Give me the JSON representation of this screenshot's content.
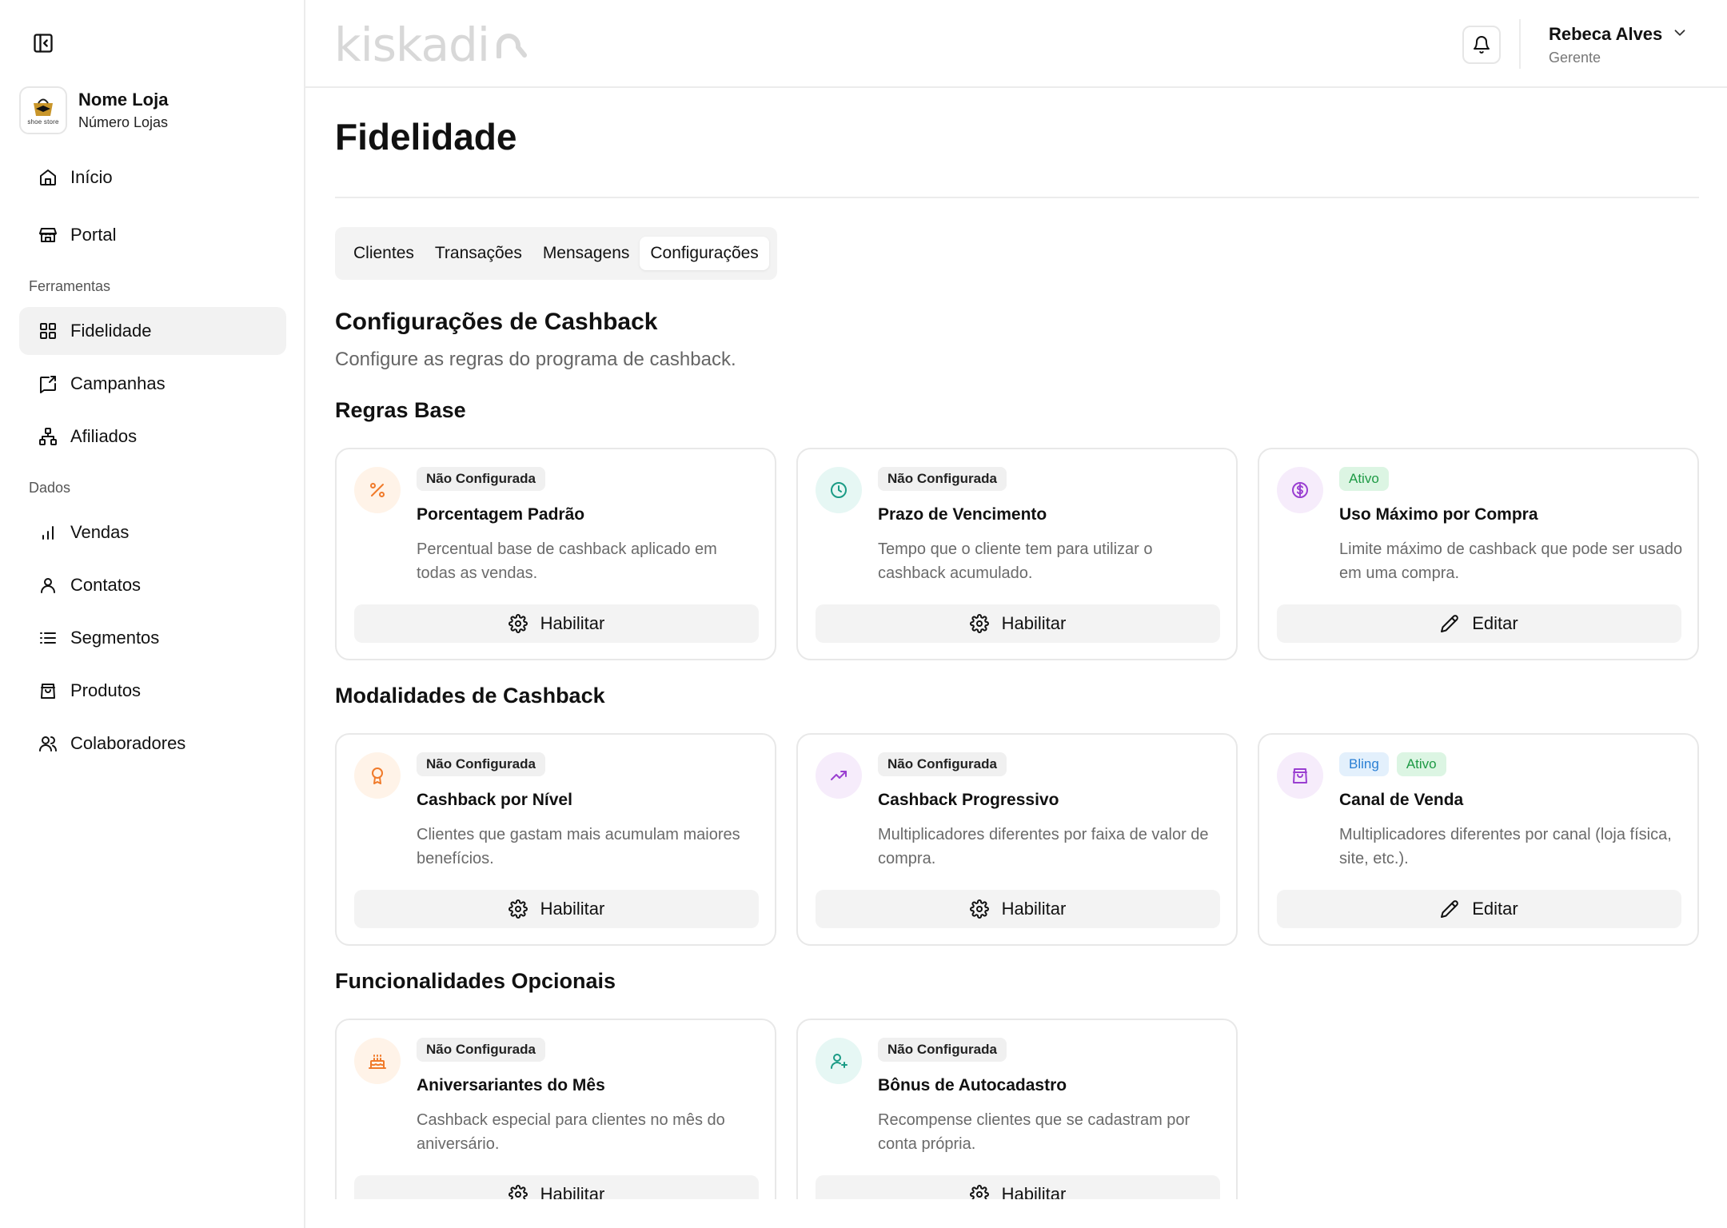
{
  "sidebar": {
    "store": {
      "name": "Nome Loja",
      "subtitle": "Número Lojas",
      "logo_text": "shoe store"
    },
    "items_top": [
      {
        "label": "Início",
        "icon": "home-icon"
      },
      {
        "label": "Portal",
        "icon": "store-icon"
      }
    ],
    "section_tools": "Ferramentas",
    "items_tools": [
      {
        "label": "Fidelidade",
        "icon": "grid-icon",
        "active": true
      },
      {
        "label": "Campanhas",
        "icon": "message-share-icon"
      },
      {
        "label": "Afiliados",
        "icon": "network-icon"
      }
    ],
    "section_data": "Dados",
    "items_data": [
      {
        "label": "Vendas",
        "icon": "bar-chart-icon"
      },
      {
        "label": "Contatos",
        "icon": "user-icon"
      },
      {
        "label": "Segmentos",
        "icon": "list-icon"
      },
      {
        "label": "Produtos",
        "icon": "shopping-bag-icon"
      },
      {
        "label": "Colaboradores",
        "icon": "users-icon"
      }
    ]
  },
  "header": {
    "brand": "kiskadi",
    "user": {
      "name": "Rebeca Alves",
      "role": "Gerente"
    }
  },
  "main": {
    "title": "Fidelidade",
    "tabs": [
      {
        "label": "Clientes",
        "active": false
      },
      {
        "label": "Transações",
        "active": false
      },
      {
        "label": "Mensagens",
        "active": false
      },
      {
        "label": "Configurações",
        "active": true
      }
    ],
    "section_title": "Configurações de Cashback",
    "section_subtitle": "Configure as regras do programa de cashback.",
    "groups": [
      {
        "title": "Regras Base",
        "cards": [
          {
            "icon": "percent-icon",
            "badges": [
              "Não Configurada"
            ],
            "title": "Porcentagem Padrão",
            "description": "Percentual base de cashback aplicado em todas as vendas.",
            "button": "Habilitar"
          },
          {
            "icon": "clock-icon",
            "badges": [
              "Não Configurada"
            ],
            "title": "Prazo de Vencimento",
            "description": "Tempo que o cliente tem para utilizar o cashback acumulado.",
            "button": "Habilitar"
          },
          {
            "icon": "dollar-circle-icon",
            "badges": [
              "Ativo"
            ],
            "title": "Uso Máximo por Compra",
            "description": "Limite máximo de cashback que pode ser usado em uma compra.",
            "button": "Editar"
          }
        ]
      },
      {
        "title": "Modalidades de Cashback",
        "cards": [
          {
            "icon": "award-icon",
            "badges": [
              "Não Configurada"
            ],
            "title": "Cashback por Nível",
            "description": "Clientes que gastam mais acumulam maiores benefícios.",
            "button": "Habilitar"
          },
          {
            "icon": "trending-up-icon",
            "badges": [
              "Não Configurada"
            ],
            "title": "Cashback Progressivo",
            "description": "Multiplicadores diferentes por faixa de valor de compra.",
            "button": "Habilitar"
          },
          {
            "icon": "shopping-bag-icon",
            "badges": [
              "Bling",
              "Ativo"
            ],
            "title": "Canal de Venda",
            "description": "Multiplicadores diferentes por canal (loja física, site, etc.).",
            "button": "Editar"
          }
        ]
      },
      {
        "title": "Funcionalidades Opcionais",
        "cards": [
          {
            "icon": "cake-icon",
            "badges": [
              "Não Configurada"
            ],
            "title": "Aniversariantes do Mês",
            "description": "Cashback especial para clientes no mês do aniversário.",
            "button": "Habilitar"
          },
          {
            "icon": "user-plus-icon",
            "badges": [
              "Não Configurada"
            ],
            "title": "Bônus de Autocadastro",
            "description": "Recompense clientes que se cadastram por conta própria.",
            "button": "Habilitar"
          }
        ]
      }
    ]
  },
  "colors": {
    "orange_icon": "#f07a2a",
    "teal_icon": "#1a9b85",
    "purple_icon": "#9a3fd1",
    "badge_green": "#1e9a45",
    "badge_blue": "#2a7fd4"
  }
}
